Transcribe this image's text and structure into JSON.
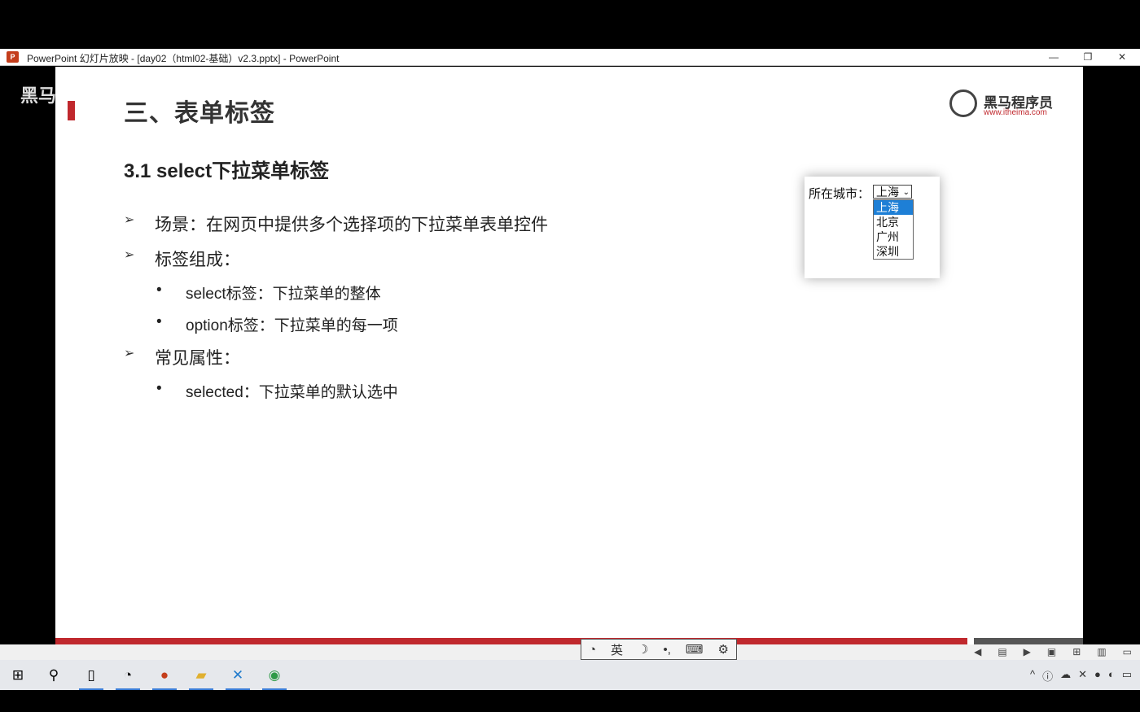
{
  "window": {
    "title": "PowerPoint 幻灯片放映 - [day02（html02-基础）v2.3.pptx] - PowerPoint",
    "app_icon": "P",
    "controls": {
      "minimize": "—",
      "restore": "❐",
      "close": "✕"
    }
  },
  "overlay_left_text": "黑马",
  "slide": {
    "title": "三、表单标签",
    "subtitle": "3.1 select下拉菜单标签",
    "logo": {
      "name": "黑马程序员",
      "url": "www.itheima.com"
    },
    "bullets": [
      {
        "level": 1,
        "text": "场景：在网页中提供多个选择项的下拉菜单表单控件"
      },
      {
        "level": 1,
        "text": "标签组成："
      },
      {
        "level": 2,
        "text": "select标签：下拉菜单的整体"
      },
      {
        "level": 2,
        "text": "option标签：下拉菜单的每一项"
      },
      {
        "level": 1,
        "text": "常见属性："
      },
      {
        "level": 2,
        "text": "selected：下拉菜单的默认选中"
      }
    ],
    "bullet_symbols": {
      "level1": "➢",
      "level2": "•"
    },
    "demo": {
      "label": "所在城市：",
      "selected": "上海",
      "options": [
        "上海",
        "北京",
        "广州",
        "深圳"
      ]
    }
  },
  "ime_toolbar": {
    "icons": [
      "ime-logo-icon",
      "moon-icon",
      "punctuation-icon",
      "keyboard-icon",
      "settings-icon"
    ],
    "mode": "英"
  },
  "taskbar": {
    "apps": [
      "windows-start-icon",
      "search-icon",
      "notepad-icon",
      "speed-icon",
      "powerpoint-icon",
      "file-explorer-icon",
      "vscode-icon",
      "chrome-icon"
    ]
  },
  "colors": {
    "accent_red": "#c0282d",
    "selection_blue": "#1e7fd6"
  }
}
